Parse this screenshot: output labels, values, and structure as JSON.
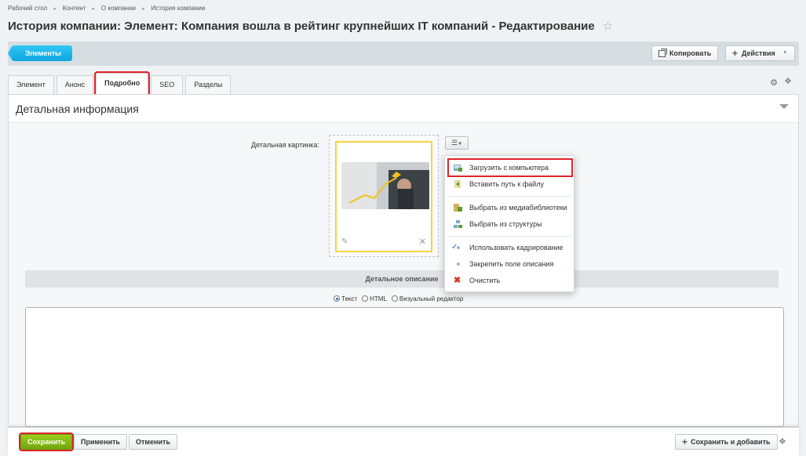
{
  "breadcrumb": [
    "Рабочий стол",
    "Контент",
    "О компании",
    "История компании"
  ],
  "title": "История компании: Элемент: Компания вошла в рейтинг крупнейших IT компаний - Редактирование",
  "toolbar": {
    "elements_label": "Элементы",
    "copy_label": "Копировать",
    "actions_label": "Действия"
  },
  "tabs": [
    {
      "label": "Элемент",
      "active": false
    },
    {
      "label": "Анонс",
      "active": false
    },
    {
      "label": "Подробно",
      "active": true
    },
    {
      "label": "SEO",
      "active": false
    },
    {
      "label": "Разделы",
      "active": false
    }
  ],
  "panel": {
    "title": "Детальная информация",
    "picture_label": "Детальная картинка:",
    "description_title": "Детальное описание",
    "radio_text": "Текст",
    "radio_html": "HTML",
    "radio_visual": "Визуальный редактор"
  },
  "menu": {
    "upload": "Загрузить с компьютера",
    "insert_path": "Вставить путь к файлу",
    "medialib": "Выбрать из медиабиблиотеки",
    "structure": "Выбрать из структуры",
    "crop": "Использовать кадрирование",
    "pin_desc": "Закрепить поле описания",
    "clear": "Очистить"
  },
  "footer": {
    "save": "Сохранить",
    "apply": "Применить",
    "cancel": "Отменить",
    "save_add": "Сохранить и добавить"
  },
  "colors": {
    "accent": "#0fa5e0",
    "save": "#7cb514",
    "highlight": "#e0232b"
  }
}
